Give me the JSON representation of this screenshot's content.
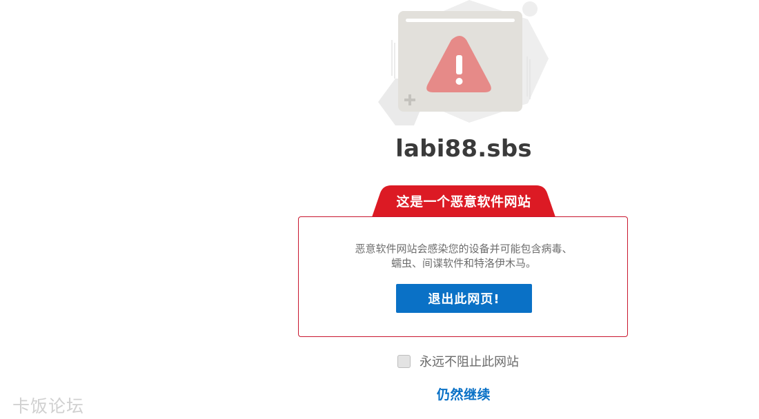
{
  "site": {
    "domain": "labi88.sbs"
  },
  "warning": {
    "title": "这是一个恶意软件网站",
    "description_line1": "恶意软件网站会感染您的设备并可能包含病毒、",
    "description_line2": "蠕虫、间谍软件和特洛伊木马。",
    "exit_button": "退出此网页!"
  },
  "options": {
    "never_block_label": "永远不阻止此网站",
    "never_block_checked": false,
    "continue_link": "仍然继续"
  },
  "watermark": {
    "text": "卡饭论坛"
  },
  "colors": {
    "accent_red": "#dc1a24",
    "button_blue": "#0a71c6",
    "warning_triangle": "#e68a88"
  },
  "icons": {
    "hero": "browser-warning-icon",
    "triangle": "warning-triangle-icon"
  }
}
